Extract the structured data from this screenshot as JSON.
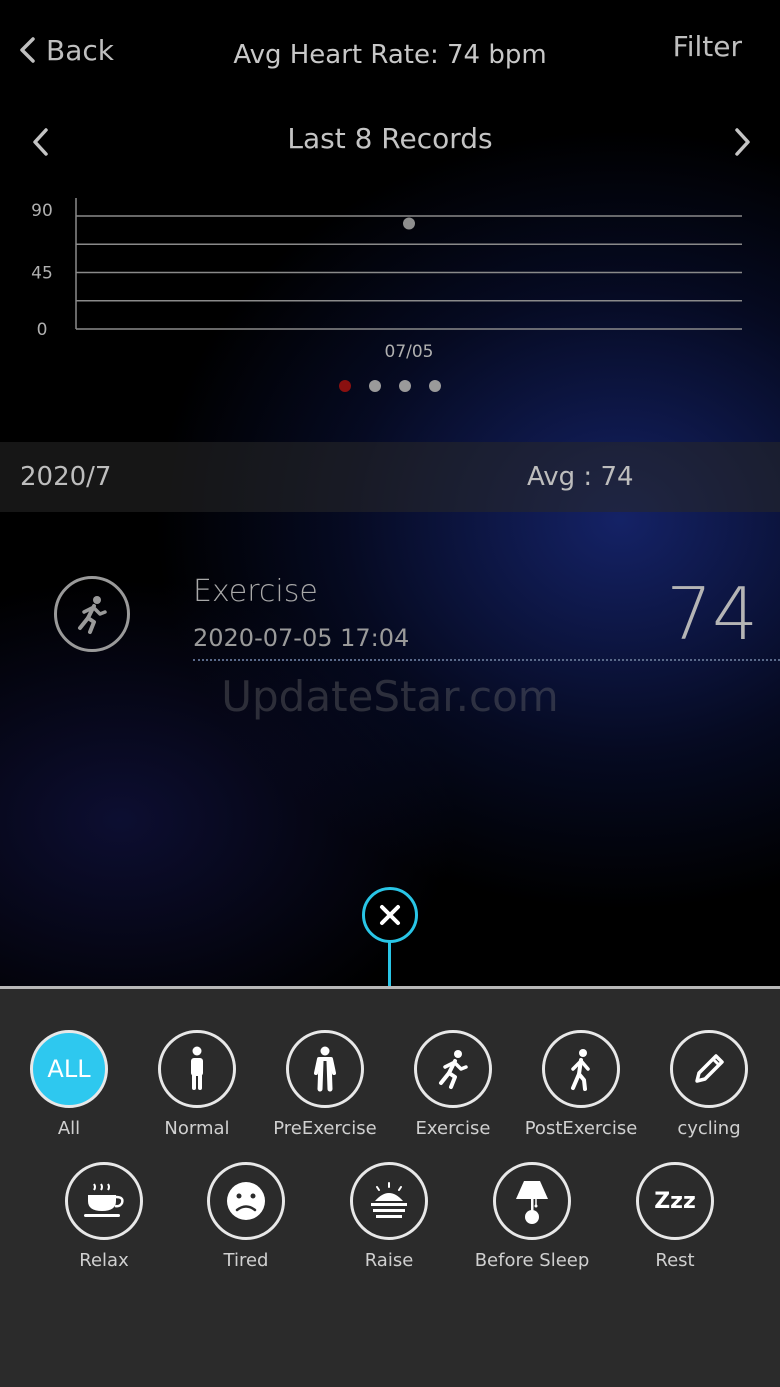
{
  "header": {
    "back_label": "Back",
    "title": "Avg Heart Rate: 74 bpm",
    "filter_label": "Filter"
  },
  "records": {
    "title": "Last 8 Records",
    "pager_dots": 4,
    "active_dot": 0
  },
  "chart_data": {
    "type": "scatter",
    "x": [
      "07/05"
    ],
    "values": [
      84
    ],
    "yticks": [
      "90",
      "45",
      "0"
    ],
    "ylim": [
      0,
      90
    ],
    "grid": true,
    "point_color": "#8e8e8e"
  },
  "summary": {
    "month": "2020/7",
    "avg": "Avg : 74"
  },
  "record_item": {
    "mode": "Exercise",
    "datetime": "2020-07-05 17:04",
    "value": "74"
  },
  "watermark": "UpdateStar.com",
  "colors": {
    "accent": "#2ec8ef",
    "active_dot": "#8a1010"
  },
  "modes_row1": [
    {
      "label": "All",
      "icon": "all-icon",
      "text": "ALL"
    },
    {
      "label": "Normal",
      "icon": "standing-person-icon"
    },
    {
      "label": "PreExercise",
      "icon": "person-icon"
    },
    {
      "label": "Exercise",
      "icon": "running-person-icon"
    },
    {
      "label": "PostExercise",
      "icon": "walking-person-icon"
    },
    {
      "label": "cycling",
      "icon": "pencil-icon"
    }
  ],
  "modes_row2": [
    {
      "label": "Relax",
      "icon": "coffee-cup-icon"
    },
    {
      "label": "Tired",
      "icon": "sad-face-icon"
    },
    {
      "label": "Raise",
      "icon": "sunrise-icon"
    },
    {
      "label": "Before Sleep",
      "icon": "lamp-icon"
    },
    {
      "label": "Rest",
      "icon": "zzz-icon",
      "text": "Zzz"
    }
  ]
}
